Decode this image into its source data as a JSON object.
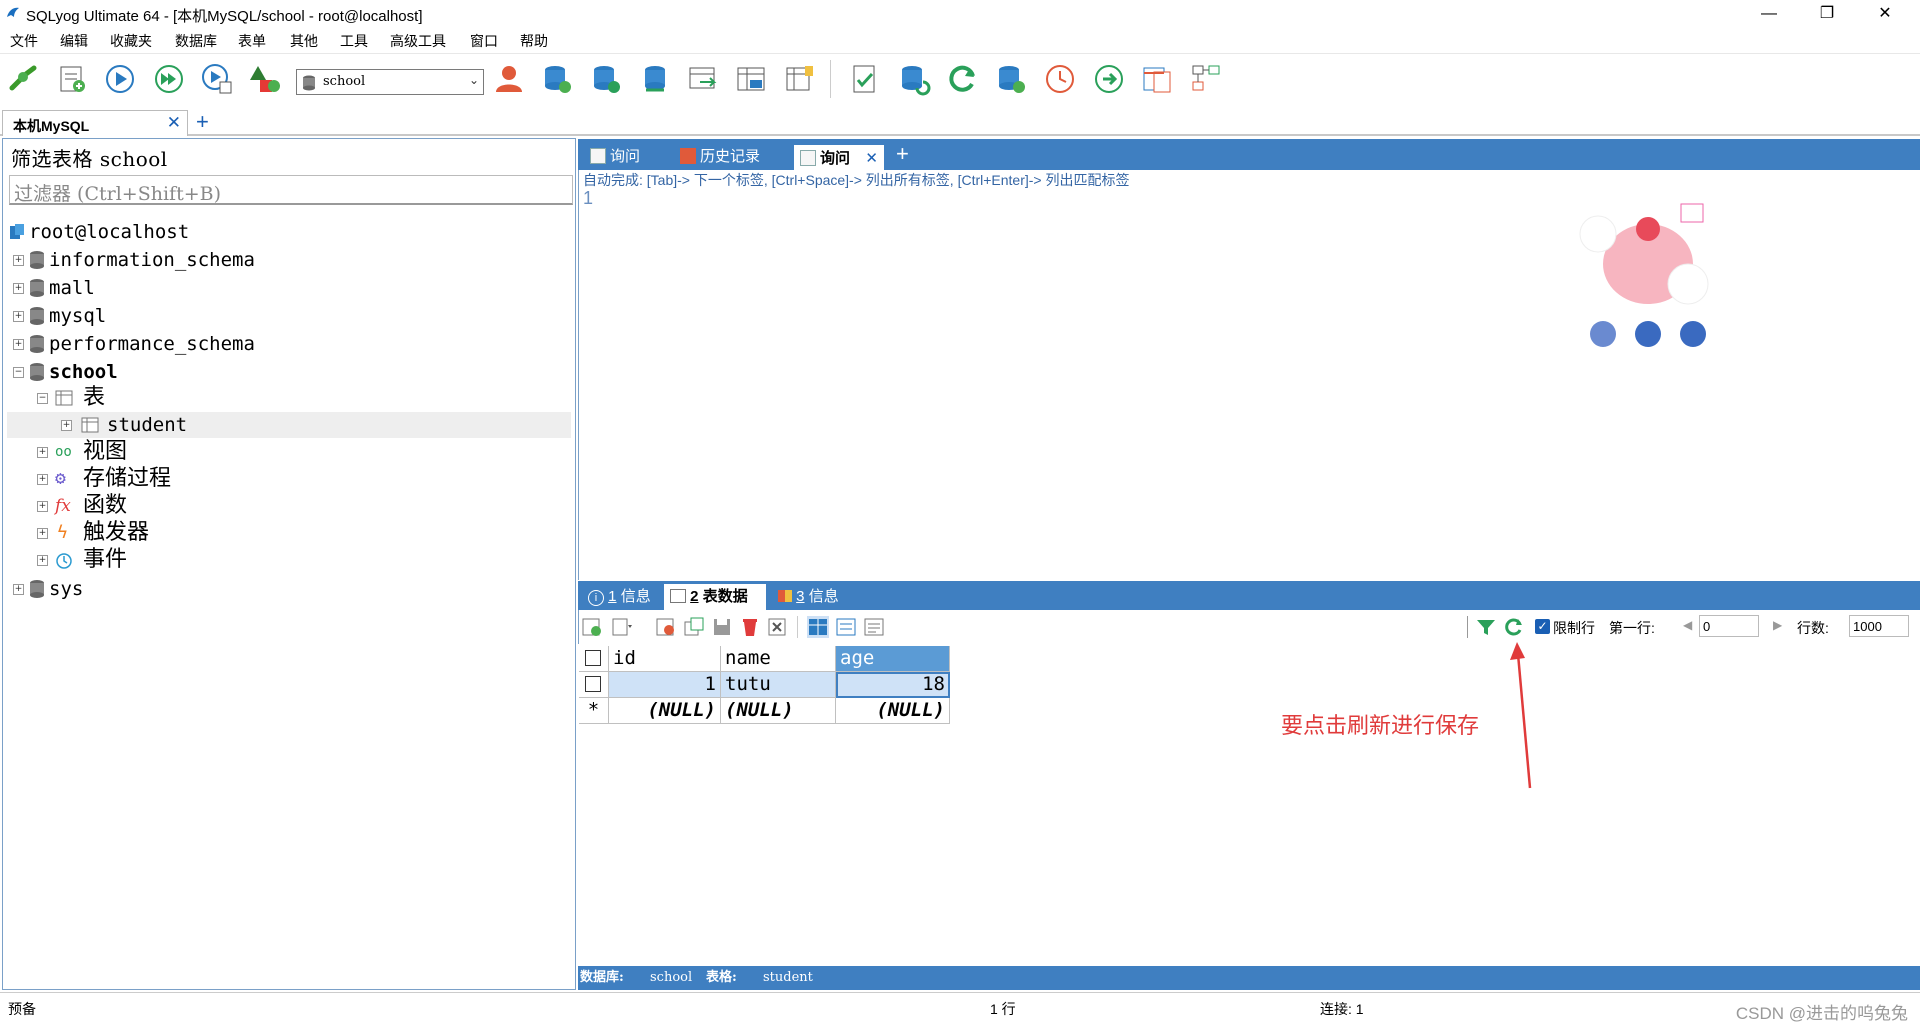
{
  "window": {
    "title": "SQLyog Ultimate 64 - [本机MySQL/school - root@localhost]",
    "controls": {
      "minimize": "—",
      "restore": "❐",
      "close": "✕"
    }
  },
  "menu": [
    "文件",
    "编辑",
    "收藏夹",
    "数据库",
    "表单",
    "其他",
    "工具",
    "高级工具",
    "窗口",
    "帮助"
  ],
  "toolbar": {
    "database_select": "school",
    "icons": [
      "new-connection-icon",
      "new-query-icon",
      "execute-icon",
      "execute-all-icon",
      "execute-edit-icon",
      "schema-icon",
      "user-manager-icon",
      "create-db-icon",
      "copy-db-icon",
      "sync-db-icon",
      "backup-icon",
      "table-data-icon",
      "import-icon",
      "schema-designer-icon",
      "query-builder-icon",
      "refresh-icon",
      "import-data-icon",
      "scheduler-icon",
      "run-icon",
      "compare-icon",
      "layout-icon"
    ]
  },
  "connection_tab": {
    "label": "本机MySQL",
    "close": "✕",
    "add": "+"
  },
  "object_browser": {
    "filter_label": "筛选表格 school",
    "filter_placeholder": "过滤器 (Ctrl+Shift+B)",
    "root": "root@localhost",
    "databases": [
      "information_schema",
      "mall",
      "mysql",
      "performance_schema"
    ],
    "school": {
      "name": "school",
      "tables_label": "表",
      "table": "student",
      "views": "视图",
      "procs": "存储过程",
      "funcs": "函数",
      "triggers": "触发器",
      "events": "事件"
    },
    "last_db": "sys"
  },
  "query_tabs": [
    {
      "label": "询问"
    },
    {
      "label": "历史记录"
    },
    {
      "label": "询问",
      "close": "✕"
    }
  ],
  "query_tab_add": "+",
  "editor": {
    "autocomplete_hint": "自动完成: [Tab]-> 下一个标签, [Ctrl+Space]-> 列出所有标签, [Ctrl+Enter]-> 列出匹配标签",
    "line_number": "1"
  },
  "result_tabs": [
    {
      "num": "1",
      "label": "信息"
    },
    {
      "num": "2",
      "label": "表数据"
    },
    {
      "num": "3",
      "label": "信息"
    }
  ],
  "grid_toolbar": {
    "limit_rows_label": "限制行",
    "first_row_label": "第一行:",
    "first_row_value": "0",
    "row_count_label": "行数:",
    "row_count_value": "1000"
  },
  "grid": {
    "columns": [
      "id",
      "name",
      "age"
    ],
    "rows": [
      {
        "marker": "",
        "id": "1",
        "name": "tutu",
        "age": "18"
      },
      {
        "marker": "*",
        "id": "(NULL)",
        "name": "(NULL)",
        "age": "(NULL)"
      }
    ]
  },
  "annotation": "要点击刷新进行保存",
  "db_info": {
    "db_label": "数据库:",
    "db_value": "school",
    "table_label": "表格:",
    "table_value": "student"
  },
  "status": {
    "left": "预备",
    "rows": "1 行",
    "connections": "连接: 1",
    "watermark": "CSDN @进击的呜兔兔"
  },
  "colors": {
    "accent": "#3f7fc1",
    "annotation": "#e03b3b",
    "header_selected": "#5b9bd5"
  }
}
